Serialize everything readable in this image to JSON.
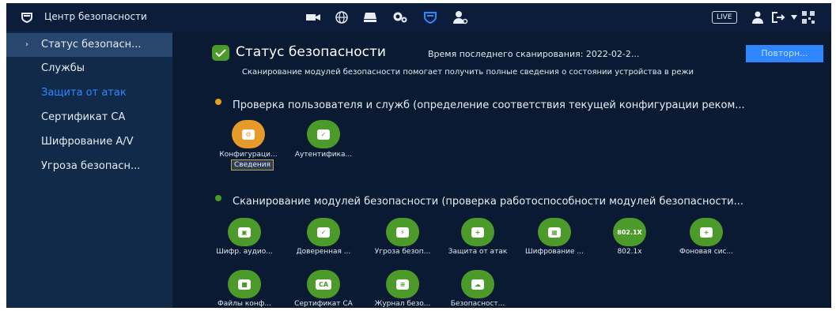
{
  "app": {
    "title": "Центр безопасности",
    "live_label": "LIVE"
  },
  "sidebar": {
    "items": [
      {
        "label": "Статус безопасн..."
      },
      {
        "label": "Службы"
      },
      {
        "label": "Защита от атак"
      },
      {
        "label": "Сертификат СА"
      },
      {
        "label": "Шифрование A/V"
      },
      {
        "label": "Угроза безопасн..."
      }
    ]
  },
  "main": {
    "title": "Статус безопасности",
    "last_scan": "Время последнего сканирования: 2022-02-2...",
    "rescan_label": "Повторн...",
    "description": "Сканирование модулей безопасности помогает получить полные сведения о состоянии устройства в режи",
    "section1": {
      "title": "Проверка пользователя и служб (определение соответствия текущей конфигурации реком...",
      "tiles": [
        {
          "label": "Конфигураци..."
        },
        {
          "label": "Аутентифика..."
        }
      ],
      "details_label": "Сведения"
    },
    "section2": {
      "title": "Сканирование модулей безопасности (проверка работоспособности модулей безопасности...",
      "tiles_row1": [
        {
          "label": "Шифр. аудио..."
        },
        {
          "label": "Доверенная ..."
        },
        {
          "label": "Угроза безоп..."
        },
        {
          "label": "Защита от атак"
        },
        {
          "label": "Шифрование ..."
        },
        {
          "label": "802.1x",
          "badge": "802.1X"
        },
        {
          "label": "Фоновая сис..."
        }
      ],
      "tiles_row2": [
        {
          "label": "Файлы конф..."
        },
        {
          "label": "Сертификат СА",
          "badge": "CA"
        },
        {
          "label": "Журнал безо..."
        },
        {
          "label": "Безопасност..."
        }
      ]
    }
  },
  "colors": {
    "accent": "#2f86ff",
    "ok": "#4c9a2a",
    "warn": "#e69a2a",
    "bg": "#0a1a33"
  }
}
